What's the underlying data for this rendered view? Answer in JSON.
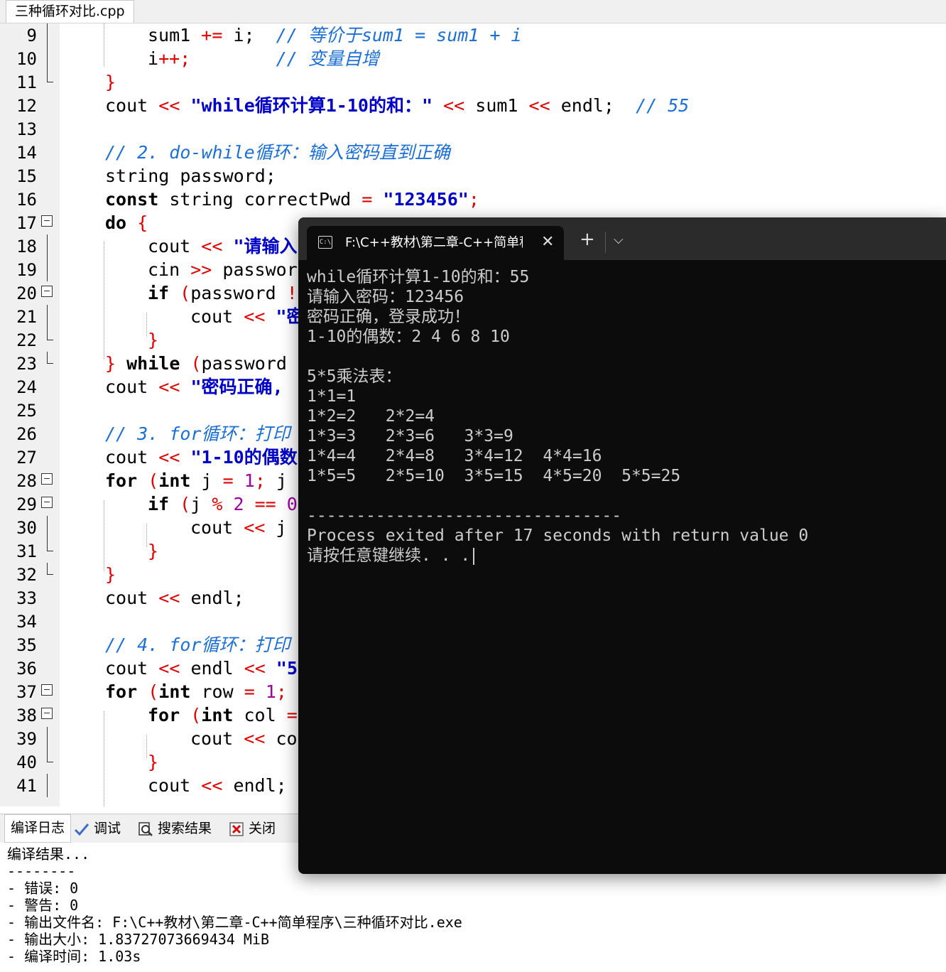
{
  "editor": {
    "file_tab": "三种循环对比.cpp",
    "lines": [
      {
        "n": "9"
      },
      {
        "n": "10"
      },
      {
        "n": "11"
      },
      {
        "n": "12"
      },
      {
        "n": "13"
      },
      {
        "n": "14"
      },
      {
        "n": "15"
      },
      {
        "n": "16"
      },
      {
        "n": "17"
      },
      {
        "n": "18"
      },
      {
        "n": "19"
      },
      {
        "n": "20"
      },
      {
        "n": "21"
      },
      {
        "n": "22"
      },
      {
        "n": "23"
      },
      {
        "n": "24"
      },
      {
        "n": "25"
      },
      {
        "n": "26"
      },
      {
        "n": "27"
      },
      {
        "n": "28"
      },
      {
        "n": "29"
      },
      {
        "n": "30"
      },
      {
        "n": "31"
      },
      {
        "n": "32"
      },
      {
        "n": "33"
      },
      {
        "n": "34"
      },
      {
        "n": "35"
      },
      {
        "n": "36"
      },
      {
        "n": "37"
      },
      {
        "n": "38"
      },
      {
        "n": "39"
      },
      {
        "n": "40"
      },
      {
        "n": "41"
      }
    ],
    "code": {
      "l9": {
        "id": "sum1",
        "op": "+=",
        "id2": "i;",
        "cm": "// 等价于sum1 = sum1 + i"
      },
      "l10": {
        "id": "i",
        "op": "++;",
        "cm": "// 变量自增"
      },
      "l11": {
        "br": "}"
      },
      "l12": {
        "a": "cout",
        "op1": "<<",
        "str": "\"while循环计算1-10的和：\"",
        "op2": "<<",
        "b": "sum1",
        "op3": "<<",
        "c": "endl;",
        "cm": "// 55"
      },
      "l14": {
        "cm": "// 2. do-while循环：输入密码直到正确"
      },
      "l15": {
        "a": "string password;"
      },
      "l16": {
        "kw": "const",
        "a": "string correctPwd",
        "op": "=",
        "str": "\"123456\"",
        "semi": ";"
      },
      "l17": {
        "kw": "do",
        "br": "{"
      },
      "l18": {
        "a": "cout",
        "op": "<<",
        "str": "\"请输入"
      },
      "l19": {
        "a": "cin",
        "op": ">>",
        "b": "passwor"
      },
      "l20": {
        "kw": "if",
        "br": "(",
        "a": "password",
        "op": "!"
      },
      "l21": {
        "a": "cout",
        "op": "<<",
        "str": "\"密"
      },
      "l22": {
        "br": "}"
      },
      "l23": {
        "br": "}",
        "kw": "while",
        "br2": "(",
        "a": "password"
      },
      "l24": {
        "a": "cout",
        "op": "<<",
        "str": "\"密码正确,"
      },
      "l26": {
        "cm": "// 3. for循环：打印"
      },
      "l27": {
        "a": "cout",
        "op": "<<",
        "str": "\"1-10的偶数"
      },
      "l28": {
        "kw": "for",
        "br": "(",
        "kw2": "int",
        "a": "j",
        "op": "=",
        "num": "1",
        "semi": ";",
        "b": "j"
      },
      "l29": {
        "kw": "if",
        "br": "(",
        "a": "j",
        "op": "%",
        "num": "2",
        "op2": "==",
        "num2": "0"
      },
      "l30": {
        "a": "cout",
        "op": "<<",
        "b": "j"
      },
      "l31": {
        "br": "}"
      },
      "l32": {
        "br": "}"
      },
      "l33": {
        "a": "cout",
        "op": "<<",
        "b": "endl;"
      },
      "l35": {
        "cm": "// 4. for循环：打印"
      },
      "l36": {
        "a": "cout",
        "op": "<<",
        "b": "endl",
        "op2": "<<",
        "str": "\"5"
      },
      "l37": {
        "kw": "for",
        "br": "(",
        "kw2": "int",
        "a": "row",
        "op": "=",
        "num": "1",
        "semi": ";"
      },
      "l38": {
        "kw": "for",
        "br": "(",
        "kw2": "int",
        "a": "col",
        "op": "="
      },
      "l39": {
        "a": "cout",
        "op": "<<",
        "b": "co"
      },
      "l40": {
        "br": "}"
      },
      "l41": {
        "a": "cout",
        "op": "<<",
        "b": "endl;"
      }
    }
  },
  "bottom": {
    "tabs": {
      "compile_log": "编译日志",
      "debug": "调试",
      "search": "搜索结果",
      "close": "关闭"
    },
    "log": [
      "编译结果...",
      "--------",
      "- 错误: 0",
      "- 警告: 0",
      "- 输出文件名: F:\\C++教材\\第二章-C++简单程序\\三种循环对比.exe",
      "- 输出大小: 1.83727073669434 MiB",
      "- 编译时间: 1.03s"
    ]
  },
  "console": {
    "tab_title": "F:\\C++教材\\第二章-C++简单程",
    "icon_text": "C:\\",
    "close_glyph": "✕",
    "new_tab": "+",
    "dropdown": "⌵",
    "output": [
      "while循环计算1-10的和：55",
      "请输入密码：123456",
      "密码正确，登录成功！",
      "1-10的偶数：2 4 6 8 10",
      "",
      "5*5乘法表：",
      "1*1=1",
      "1*2=2   2*2=4",
      "1*3=3   2*3=6   3*3=9",
      "1*4=4   2*4=8   3*4=12  4*4=16",
      "1*5=5   2*5=10  3*5=15  4*5=20  5*5=25",
      "",
      "--------------------------------",
      "Process exited after 17 seconds with return value 0",
      "请按任意键继续. . ."
    ]
  }
}
